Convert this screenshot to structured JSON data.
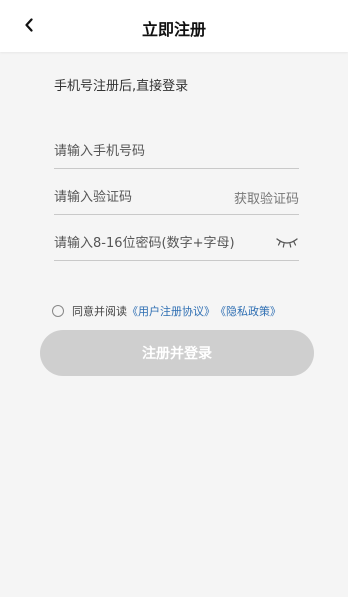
{
  "header": {
    "back_icon": "chevron-left-icon",
    "title": "立即注册"
  },
  "form": {
    "subtitle": "手机号注册后,直接登录",
    "phone_placeholder": "请输入手机号码",
    "code_placeholder": "请输入验证码",
    "get_code_label": "获取验证码",
    "password_placeholder": "请输入8-16位密码(数字+字母)",
    "password_toggle_icon": "eye-closed-icon"
  },
  "agreement": {
    "prefix": "同意并阅读",
    "user_agreement": "《用户注册协议》",
    "privacy_policy": "《隐私政策》",
    "checked": false
  },
  "submit": {
    "label": "注册并登录"
  },
  "colors": {
    "background": "#f5f5f5",
    "link": "#2f6fb3",
    "button_disabled": "#cfcfcf"
  }
}
